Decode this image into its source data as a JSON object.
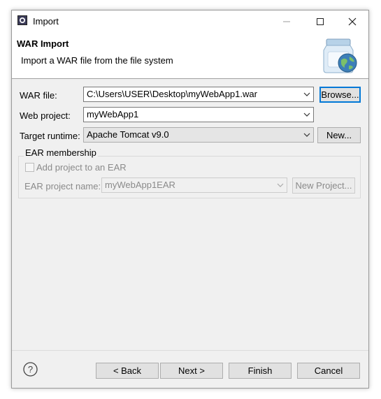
{
  "window": {
    "title": "Import"
  },
  "banner": {
    "title": "WAR Import",
    "description": "Import a WAR file from the file system"
  },
  "form": {
    "war_file": {
      "label": "WAR file:",
      "value": "C:\\Users\\USER\\Desktop\\myWebApp1.war",
      "button": "Browse..."
    },
    "web_project": {
      "label": "Web project:",
      "value": "myWebApp1"
    },
    "target_runtime": {
      "label": "Target runtime:",
      "value": "Apache Tomcat v9.0",
      "button": "New..."
    }
  },
  "ear": {
    "group_title": "EAR membership",
    "checkbox_label": "Add project to an EAR",
    "checked": false,
    "project_label": "EAR project name:",
    "project_value": "myWebApp1EAR",
    "new_project_button": "New Project..."
  },
  "footer": {
    "back": "< Back",
    "next": "Next >",
    "finish": "Finish",
    "cancel": "Cancel"
  },
  "colors": {
    "focus_accent": "#0078d7",
    "dialog_bg": "#f0f0f0"
  },
  "icons": [
    "eclipse-app-icon",
    "minimize-icon",
    "maximize-icon",
    "close-icon",
    "war-import-jar-icon",
    "chevron-down-icon",
    "help-icon"
  ]
}
